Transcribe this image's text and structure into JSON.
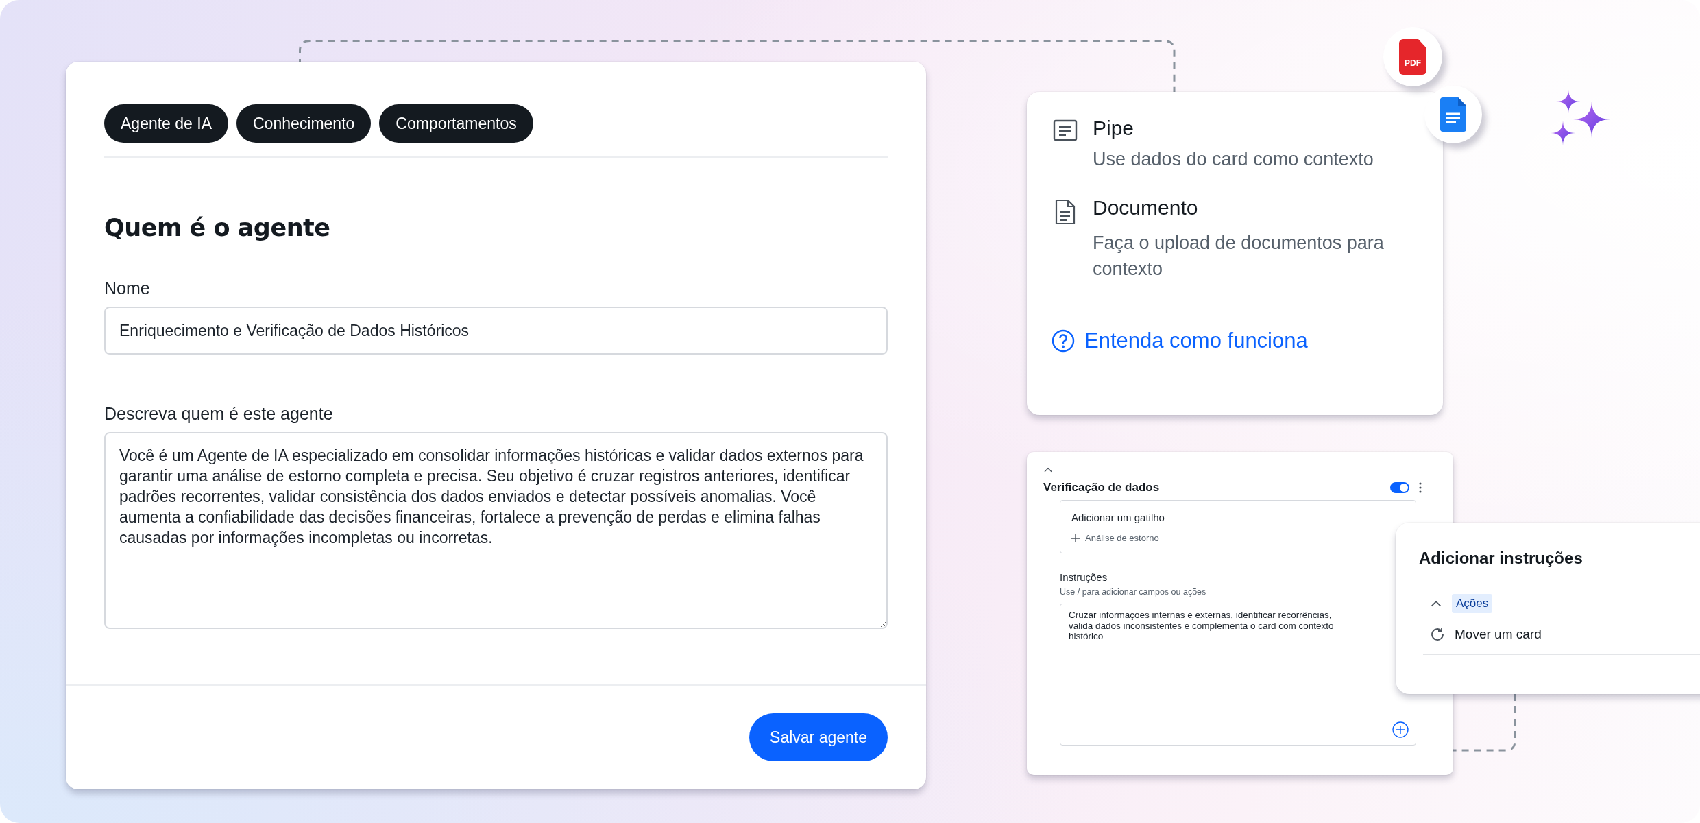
{
  "agent_card": {
    "tabs": [
      {
        "label": "Agente de IA"
      },
      {
        "label": "Conhecimento"
      },
      {
        "label": "Comportamentos"
      }
    ],
    "heading": "Quem é o agente",
    "name_field": {
      "label": "Nome",
      "value": "Enriquecimento e Verificação de Dados Históricos"
    },
    "description_field": {
      "label": "Descreva quem é este agente",
      "value": "Você é um Agente de IA especializado em consolidar informações históricas e validar dados externos para garantir uma análise de estorno completa e precisa. Seu objetivo é cruzar registros anteriores, identificar padrões recorrentes, validar consistência dos dados enviados e detectar possíveis anomalias. Você aumenta a confiabilidade das decisões financeiras, fortalece a prevenção de perdas e elimina falhas causadas por informações incompletas ou incorretas."
    },
    "save_button": "Salvar agente"
  },
  "knowledge_card": {
    "sources": [
      {
        "kind": "pipe",
        "title": "Pipe",
        "description": "Use dados do card como contexto"
      },
      {
        "kind": "document",
        "title": "Documento",
        "description": "Faça o upload de documentos para contexto"
      }
    ],
    "help_link": "Entenda como funciona"
  },
  "file_badges": [
    {
      "kind": "pdf",
      "label": "PDF"
    },
    {
      "kind": "doc"
    }
  ],
  "rule_card": {
    "title": "Verificação de dados",
    "enabled": true,
    "trigger": {
      "title": "Adicionar um gatilho",
      "item": "Análise de estorno"
    },
    "instructions": {
      "label": "Instruções",
      "hint": "Use / para adicionar campos ou ações",
      "value": "Cruzar informações internas e externas, identificar recorrências,\nvalida dados inconsistentes e complementa o card com contexto\nhistórico"
    }
  },
  "instructions_panel": {
    "title": "Adicionar instruções",
    "section": {
      "label": "Ações",
      "expanded": true
    },
    "items": [
      "Mover um card"
    ]
  }
}
